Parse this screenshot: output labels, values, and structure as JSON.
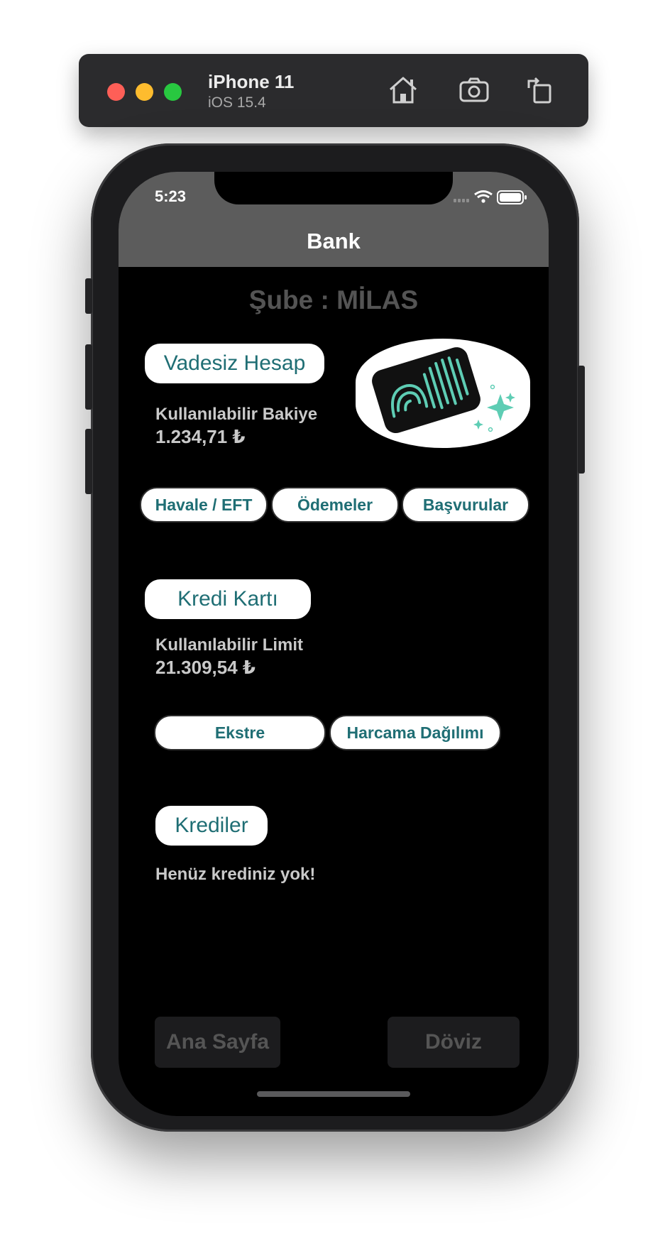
{
  "simulator": {
    "device": "iPhone 11",
    "os": "iOS 15.4",
    "icons": [
      "home-icon",
      "screenshot-icon",
      "rotate-icon"
    ]
  },
  "status_bar": {
    "time": "5:23"
  },
  "nav": {
    "title": "Bank"
  },
  "branch": "Şube : MİLAS",
  "account": {
    "title": "Vadesiz Hesap",
    "balance_label": "Kullanılabilir Bakiye",
    "balance": "1.234,71 ₺",
    "actions": [
      "Havale / EFT",
      "Ödemeler",
      "Başvurular"
    ]
  },
  "credit_card": {
    "title": "Kredi Kartı",
    "limit_label": "Kullanılabilir Limit",
    "limit": "21.309,54 ₺",
    "actions": [
      "Ekstre",
      "Harcama Dağılımı"
    ]
  },
  "loans": {
    "title": "Krediler",
    "message": "Henüz krediniz yok!"
  },
  "tabs": [
    "Ana Sayfa",
    "Döviz"
  ],
  "colors": {
    "accent": "#1f6e74",
    "navbar": "#5c5c5c",
    "screen_bg": "#000000",
    "card_accent": "#5ecdb4"
  }
}
